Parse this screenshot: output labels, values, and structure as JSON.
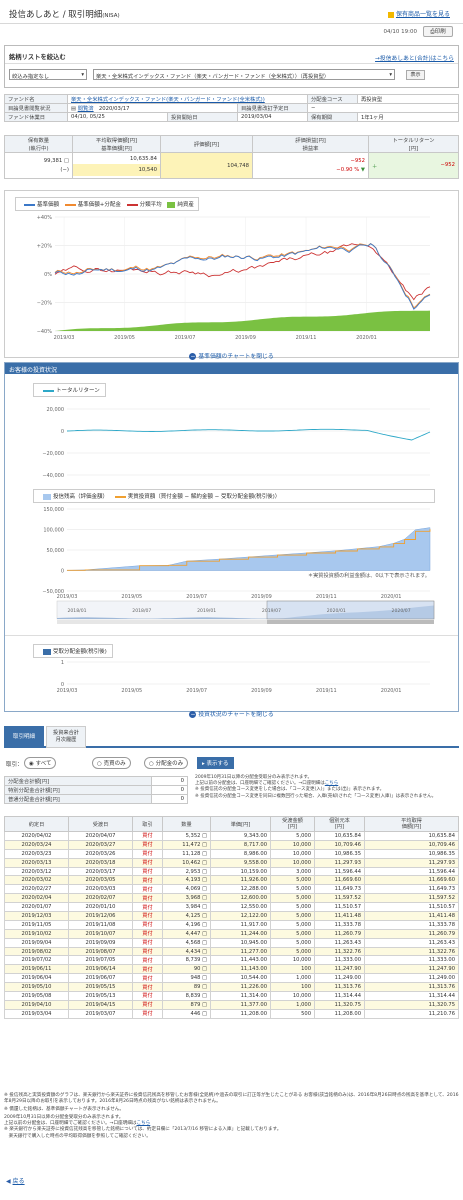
{
  "header": {
    "title": "投信あしあと / 取引明細",
    "title_suffix": "(NISA)",
    "top_link": "保有商品一覧を見る",
    "timestamp": "04/10 19:00",
    "print_label": "印刷"
  },
  "filter": {
    "title": "銘柄リストを絞込む",
    "all_link": "→投信あしあと(合計)はこちら",
    "select1": "絞込み指定なし",
    "select2": "楽天・全米株式インデックス・ファンド（楽天・バンガード・ファンド（全米株式））（再投資型）",
    "show_label": "表示"
  },
  "fund": {
    "r1": {
      "l1": "ファンド名",
      "v1": "楽天・全米株式インデックス・ファンド(楽天・バンガード・ファンド(全米株式))",
      "l2": "分配金コース",
      "v2": "再投資型"
    },
    "r2": {
      "l1": "目論見書閲覧状況",
      "v1a": "閲覧済",
      "v1b": "2020/03/17",
      "l2": "目論見書改訂予定日",
      "v2": "−"
    },
    "r3": {
      "l1": "ファンド休業日",
      "v1": "04/10, 05/25",
      "l2": "投資開始日",
      "v2": "2019/03/04",
      "l3": "保有期間",
      "v3": "1年1ヶ月"
    }
  },
  "summary": {
    "headers": [
      "保有数量\n(執行中)",
      "平均取得価額[円]\n基準価額[円]",
      "評価額[円]",
      "評価損益[円]\n損益率",
      "トータルリターン\n[円]"
    ],
    "qty": "99,381",
    "qty_exec": "(−)",
    "avg_price": "10,635.84",
    "nav": "10,540",
    "value": "104,748",
    "pl": "−952",
    "pl_rate": "−0.90 %",
    "total_return": "−952"
  },
  "nav_chart": {
    "legend": [
      "基準価額",
      "基準価額+分配金",
      "分類平均",
      "純資産"
    ],
    "yticks": [
      "+40%",
      "+20%",
      "0%",
      "−20%",
      "−40%"
    ],
    "xticks": [
      "2019/03",
      "2019/05",
      "2019/07",
      "2019/09",
      "2019/11",
      "2020/01"
    ],
    "toggle": "基準価額のチャートを閉じる",
    "colors": {
      "nav": "#3b78c8",
      "navdiv": "#f08a30",
      "cat": "#cc3333",
      "aum": "#7ac142"
    }
  },
  "invest": {
    "title": "お客様の投資状況",
    "tr_legend": "トータルリターン",
    "tr_yticks": [
      "20,000",
      "0",
      "−20,000",
      "−40,000"
    ],
    "bal_legend": [
      "投信残高（評価金額）",
      "実質投資額（買付金額 − 解約金額 − 受取分配金額(税引後)）"
    ],
    "bal_yticks": [
      "150,000",
      "100,000",
      "50,000",
      "0",
      "−50,000"
    ],
    "bal_note": "＊実質投資額の利益金額は、0以下で表示されます。",
    "xticks": [
      "2019/03",
      "2019/05",
      "2019/07",
      "2019/09",
      "2019/11",
      "2020/01"
    ],
    "nav_years": [
      "2018/01",
      "2018/07",
      "2019/01",
      "2019/07",
      "2020/01",
      "2020/07"
    ],
    "div_legend": "受取分配金額(税引後)",
    "div_yticks": [
      "1",
      "0"
    ],
    "toggle": "投資状況のチャートを閉じる"
  },
  "tabs": {
    "t1": "取引明細",
    "t2": "投資来合計\n月次履歴"
  },
  "trade_filter": {
    "label": "取引：",
    "all": "すべて",
    "sell": "売買のみ",
    "div": "分配金のみ",
    "show": "表示する"
  },
  "div_totals": [
    {
      "label": "分配金合計額[円]",
      "value": "0"
    },
    {
      "label": "特別分配金合計額[円]",
      "value": "0"
    },
    {
      "label": "普通分配金合計額[円]",
      "value": "0"
    }
  ],
  "notes_right": [
    "2009年10月31日以降の分配金受取分のみ表示されます。",
    "上記以前の分配金は、口座明細でご確認ください。→口座明細は",
    "こちら",
    "※ 投資信託の分配金コース変更をした場合は、「コース変更(入)」または(出)」表示されます。",
    "※ 投資信託の分配金コース変更を同日に複数回行った場合、入庫(売却)された「コース変更(入庫)」は表示されません。"
  ],
  "trades": {
    "headers": [
      "約定日",
      "受渡日",
      "取引",
      "数量",
      "単価[円]",
      "受渡金額\n[円]",
      "個別元本\n[円]",
      "平均取得\n価額[円]"
    ],
    "rows": [
      [
        "2020/04/02",
        "2020/04/07",
        "買付",
        "5,352",
        "9,343.00",
        "5,000",
        "10,635.84",
        "10,635.84"
      ],
      [
        "2020/03/24",
        "2020/03/27",
        "買付",
        "11,472",
        "8,717.00",
        "10,000",
        "10,709.46",
        "10,709.46"
      ],
      [
        "2020/03/23",
        "2020/03/26",
        "買付",
        "11,128",
        "8,986.00",
        "10,000",
        "10,986.35",
        "10,986.35"
      ],
      [
        "2020/03/13",
        "2020/03/18",
        "買付",
        "10,462",
        "9,558.00",
        "10,000",
        "11,297.93",
        "11,297.93"
      ],
      [
        "2020/03/12",
        "2020/03/17",
        "買付",
        "2,953",
        "10,159.00",
        "3,000",
        "11,596.44",
        "11,596.44"
      ],
      [
        "2020/03/02",
        "2020/03/05",
        "買付",
        "4,193",
        "11,926.00",
        "5,000",
        "11,669.60",
        "11,669.60"
      ],
      [
        "2020/02/27",
        "2020/03/03",
        "買付",
        "4,069",
        "12,288.00",
        "5,000",
        "11,649.73",
        "11,649.73"
      ],
      [
        "2020/02/04",
        "2020/02/07",
        "買付",
        "3,968",
        "12,600.00",
        "5,000",
        "11,597.52",
        "11,597.52"
      ],
      [
        "2020/01/07",
        "2020/01/10",
        "買付",
        "3,984",
        "12,550.00",
        "5,000",
        "11,510.57",
        "11,510.57"
      ],
      [
        "2019/12/03",
        "2019/12/06",
        "買付",
        "4,125",
        "12,122.00",
        "5,000",
        "11,411.48",
        "11,411.48"
      ],
      [
        "2019/11/05",
        "2019/11/08",
        "買付",
        "4,196",
        "11,917.00",
        "5,000",
        "11,333.78",
        "11,333.78"
      ],
      [
        "2019/10/02",
        "2019/10/07",
        "買付",
        "4,447",
        "11,244.00",
        "5,000",
        "11,260.79",
        "11,260.79"
      ],
      [
        "2019/09/04",
        "2019/09/09",
        "買付",
        "4,568",
        "10,945.00",
        "5,000",
        "11,263.43",
        "11,263.43"
      ],
      [
        "2019/08/02",
        "2019/08/07",
        "買付",
        "4,434",
        "11,277.00",
        "5,000",
        "11,322.76",
        "11,322.76"
      ],
      [
        "2019/07/02",
        "2019/07/05",
        "買付",
        "8,739",
        "11,443.00",
        "10,000",
        "11,333.00",
        "11,333.00"
      ],
      [
        "2019/06/11",
        "2019/06/14",
        "買付",
        "90",
        "11,143.00",
        "100",
        "11,247.90",
        "11,247.90"
      ],
      [
        "2019/06/04",
        "2019/06/07",
        "買付",
        "948",
        "10,544.00",
        "1,000",
        "11,249.00",
        "11,249.00"
      ],
      [
        "2019/05/10",
        "2019/05/15",
        "買付",
        "89",
        "11,226.00",
        "100",
        "11,313.76",
        "11,313.76"
      ],
      [
        "2019/05/08",
        "2019/05/13",
        "買付",
        "8,839",
        "11,314.00",
        "10,000",
        "11,314.44",
        "11,314.44"
      ],
      [
        "2019/04/10",
        "2019/04/15",
        "買付",
        "879",
        "11,377.00",
        "1,000",
        "11,320.75",
        "11,320.75"
      ],
      [
        "2019/03/04",
        "2019/03/07",
        "買付",
        "446",
        "11,208.00",
        "500",
        "11,208.00",
        "11,210.76"
      ]
    ]
  },
  "footnotes": [
    "※ 投信残高と実質投資額のグラフは、楽天銀行から楽天証券に投資信託残高を移管したお客様(全銘柄)や過去の取引に訂正等が生じたことがある お客様(該当銘柄のみ)は、2016年8月26日時点の残高を基準として、2016年8月29日以降のお取引を表示しております。2016年8月26日時点の残高がない銘柄は表示されません。",
    "※ 償還した銘柄は、基準価額チャートが表示されません。",
    "2009年10月31日以降の分配金受取分のみ表示されます。",
    "上記以前の分配金は、口座明細でご確認ください。→口座明細は",
    "こちら",
    "※ 楽天銀行から楽天証券に投資信託残高を移管した銘柄については、約定日欄に「2013/7/16 移管による入庫」と記載しております。",
    "　楽天銀行で購入した時点の平均取得価額を参照してご確認ください。"
  ],
  "back": "戻る"
}
